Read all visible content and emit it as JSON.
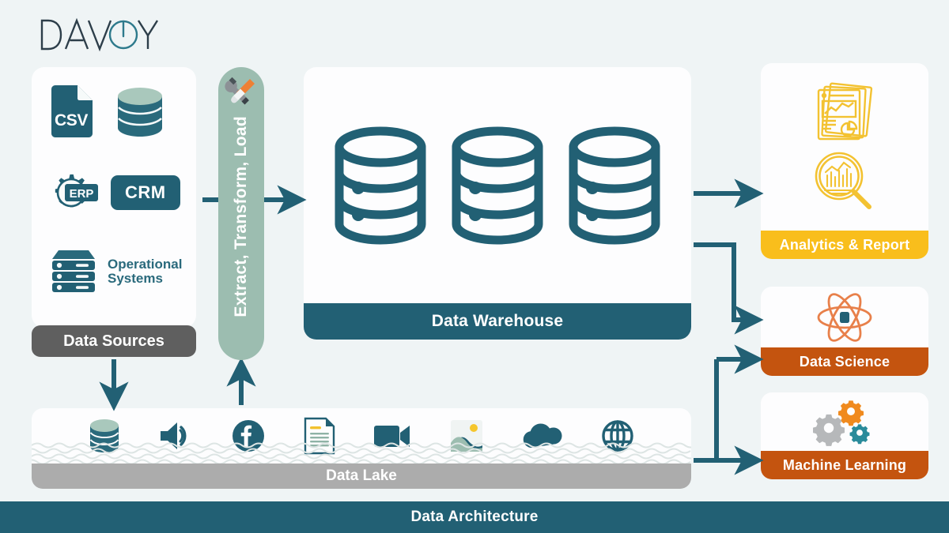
{
  "brand": {
    "name": "DAVOY",
    "icon": "power-circle-icon"
  },
  "footer": {
    "title": "Data Architecture"
  },
  "colors": {
    "background": "#EFF4F5",
    "panel": "#FDFDFE",
    "teal": "#226074",
    "teal_light": "#2A6A7C",
    "sage": "#9CBDB0",
    "sage_dark": "#8FB3A6",
    "gray_label": "#5F5F5F",
    "gray_lake": "#ACACAC",
    "amber": "#F9BE1C",
    "orange_dark": "#C4540F",
    "orange": "#E8862A",
    "gear_gray": "#B6B8BA",
    "gear_teal": "#2A8B9B"
  },
  "data_sources": {
    "label": "Data Sources",
    "items": [
      {
        "icon": "csv-file-icon",
        "label": "CSV"
      },
      {
        "icon": "database-cylinder-icon",
        "label": ""
      },
      {
        "icon": "erp-gear-icon",
        "label": "ERP"
      },
      {
        "icon": "crm-chip-icon",
        "label": "CRM"
      },
      {
        "icon": "server-rack-icon",
        "label": "Operational Systems"
      }
    ],
    "operational_line1": "Operational",
    "operational_line2": "Systems"
  },
  "etl": {
    "label": "Extract, Transform, Load",
    "icon": "wrench-screwdriver-icon"
  },
  "data_warehouse": {
    "label": "Data Warehouse",
    "icon_count": 3,
    "icon": "database-stack-outline-icon"
  },
  "data_lake": {
    "label": "Data Lake",
    "icons": [
      {
        "name": "database-cylinder-icon"
      },
      {
        "name": "speaker-audio-icon"
      },
      {
        "name": "facebook-icon"
      },
      {
        "name": "document-text-icon"
      },
      {
        "name": "video-camera-icon"
      },
      {
        "name": "image-photo-icon"
      },
      {
        "name": "cloud-icon"
      },
      {
        "name": "globe-icon"
      }
    ]
  },
  "outputs": [
    {
      "id": "analytics",
      "label": "Analytics & Report",
      "icons": [
        "report-documents-icon",
        "chart-magnifier-icon"
      ],
      "accent": "#F9BE1C"
    },
    {
      "id": "data-science",
      "label": "Data Science",
      "icons": [
        "atom-icon"
      ],
      "accent": "#C4540F"
    },
    {
      "id": "machine-learning",
      "label": "Machine Learning",
      "icons": [
        "gears-icon"
      ],
      "accent": "#C4540F"
    }
  ],
  "flow": {
    "arrows": [
      {
        "from": "data-sources",
        "to": "data-warehouse",
        "direction": "right"
      },
      {
        "from": "data-sources",
        "to": "data-lake",
        "direction": "down"
      },
      {
        "from": "data-lake",
        "to": "etl",
        "direction": "up"
      },
      {
        "from": "data-warehouse",
        "to": "analytics",
        "direction": "right"
      },
      {
        "from": "data-warehouse",
        "to": "data-science",
        "direction": "right"
      },
      {
        "from": "data-lake",
        "to": "data-science",
        "direction": "right"
      },
      {
        "from": "data-lake",
        "to": "machine-learning",
        "direction": "right"
      }
    ]
  }
}
